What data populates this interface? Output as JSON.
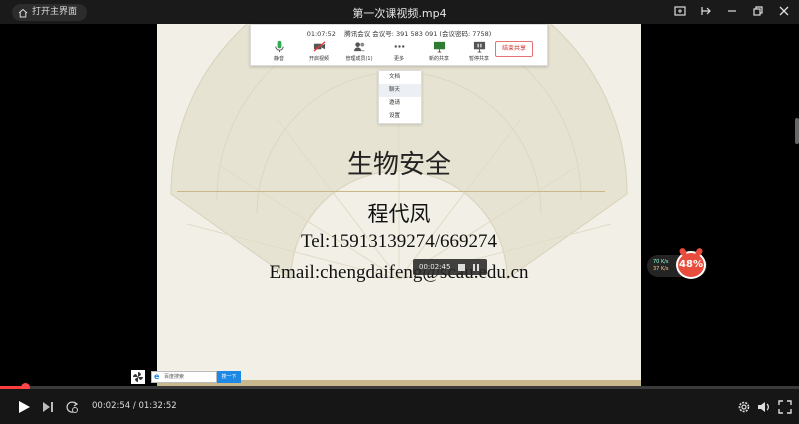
{
  "titlebar": {
    "home_label": "打开主界面",
    "title": "第一次课视频.mp4"
  },
  "meeting": {
    "time": "01:07:52",
    "info": "腾讯会议 会议号: 391 583 091 (会议密码: 7758)",
    "tools": [
      {
        "label": "静音",
        "icon": "mic-icon"
      },
      {
        "label": "开启视频",
        "icon": "camera-off-icon"
      },
      {
        "label": "管理成员(1)",
        "icon": "members-icon"
      },
      {
        "label": "更多",
        "icon": "more-icon"
      },
      {
        "label": "新的共享",
        "icon": "new-share-icon"
      },
      {
        "label": "暂停共享",
        "icon": "pause-share-icon"
      }
    ],
    "stop_share": "结束共享",
    "menu": [
      "文档",
      "聊天",
      "邀请",
      "设置"
    ]
  },
  "slide": {
    "title": "生物安全",
    "name": "程代凤",
    "tel": "Tel:15913139274/669274",
    "email": "Email:chengdaifeng@scau.edu.cn"
  },
  "recording": {
    "time": "00:02:45"
  },
  "network": {
    "up": "70 K/s",
    "down": "37 K/s",
    "percent": "48%"
  },
  "taskbar": {
    "search_text": "百度搜索",
    "search_button": "搜一下"
  },
  "player": {
    "current_time": "00:02:54",
    "separator": " / ",
    "total_time": "01:32:52",
    "progress_fraction": 0.031
  },
  "colors": {
    "accent": "#ff3d3d",
    "titlebar_bg": "#1a1a1a",
    "controls_bg": "#161616"
  }
}
